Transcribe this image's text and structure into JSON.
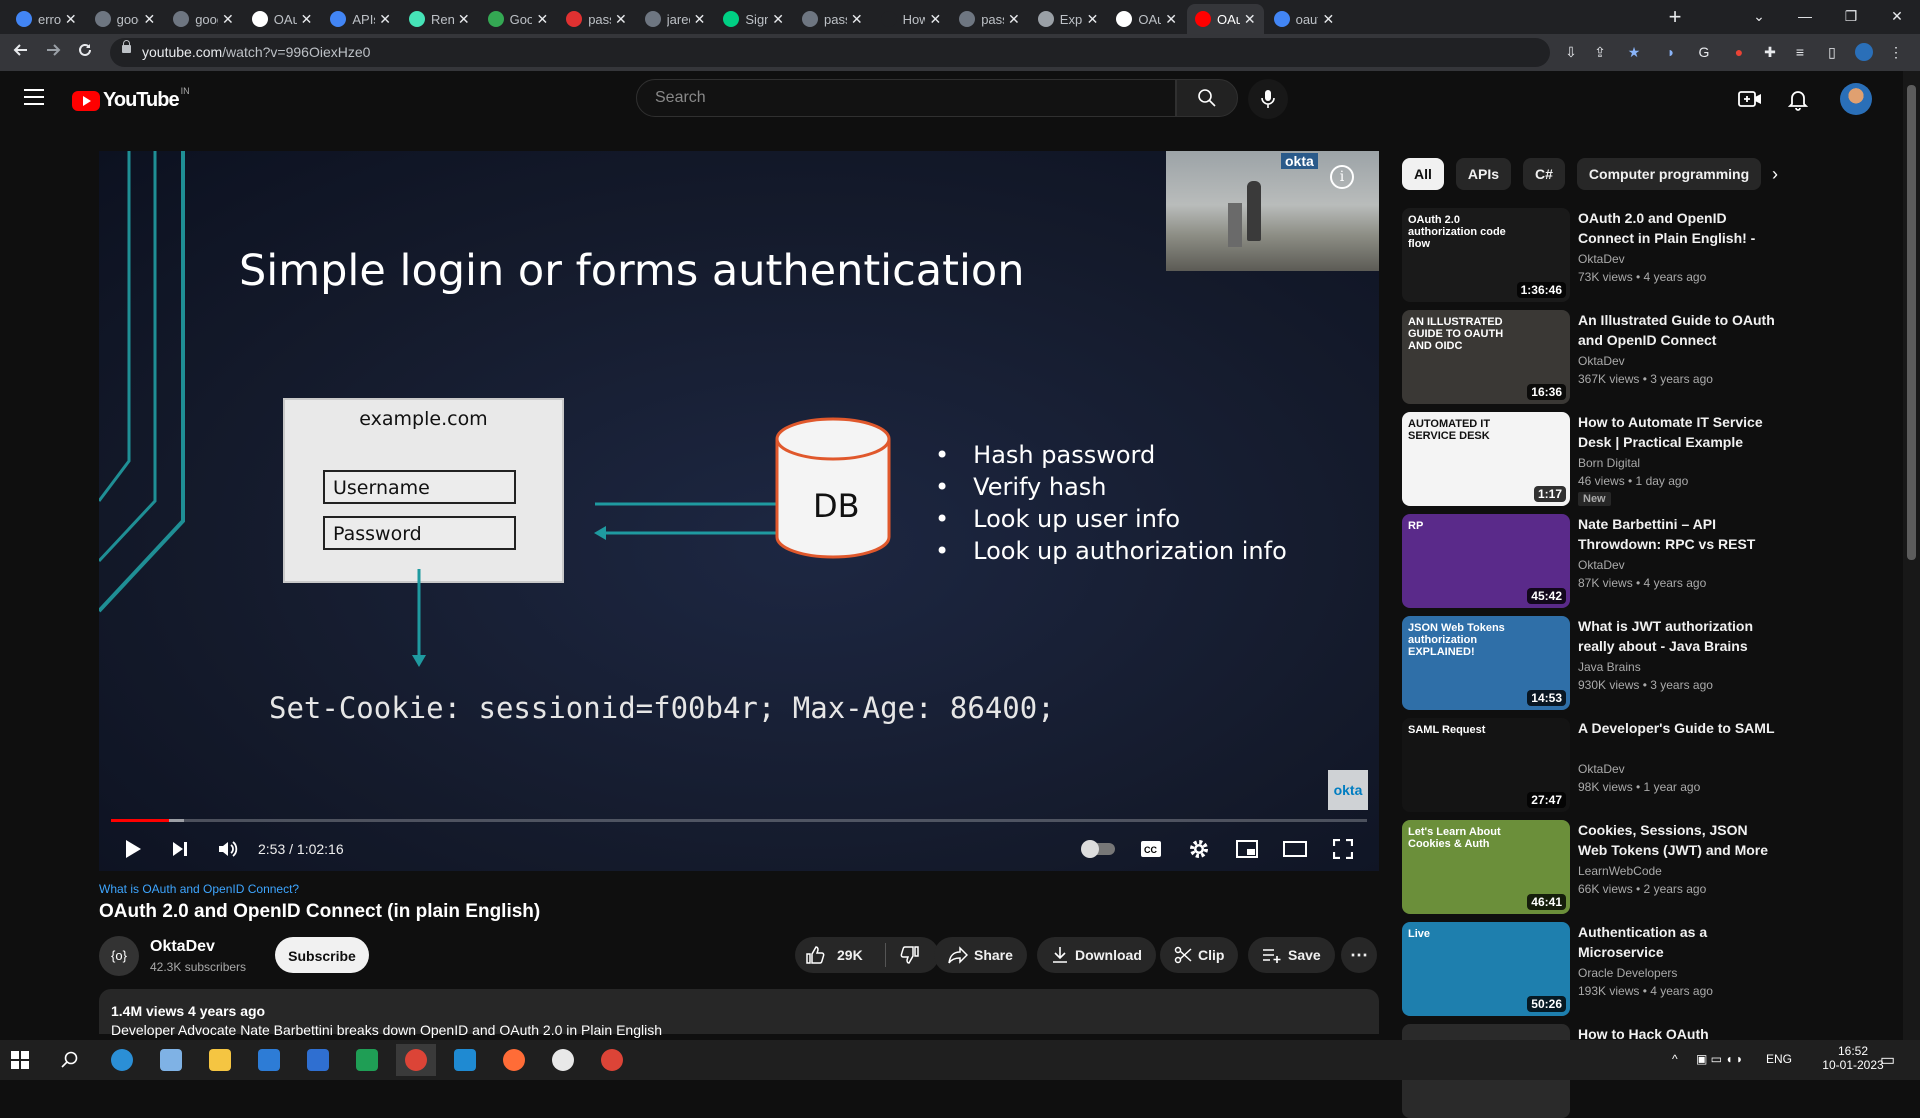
{
  "browser": {
    "tabs": [
      {
        "title": "error i",
        "color": "#4285f4"
      },
      {
        "title": "googl",
        "color": "#6e7681"
      },
      {
        "title": "googl",
        "color": "#6e7681"
      },
      {
        "title": "OAuth",
        "color": "#ffffff"
      },
      {
        "title": "APIs &",
        "color": "#4285f4"
      },
      {
        "title": "Rende",
        "color": "#46e3b7"
      },
      {
        "title": "Googl",
        "color": "#34a853"
      },
      {
        "title": "passp",
        "color": "#e03131"
      },
      {
        "title": "jaredh",
        "color": "#6e7681"
      },
      {
        "title": "Sign In",
        "color": "#00d084"
      },
      {
        "title": "passp",
        "color": "#6e7681"
      },
      {
        "title": "How t",
        "color": "#202124"
      },
      {
        "title": "passp",
        "color": "#6e7681"
      },
      {
        "title": "Expre",
        "color": "#9aa0a6"
      },
      {
        "title": "OAuth",
        "color": "#ffffff"
      },
      {
        "title": "OAuth",
        "color": "#ff0000",
        "active": true
      },
      {
        "title": "oauth",
        "color": "#4285f4"
      }
    ],
    "url_host": "youtube.com",
    "url_path": "/watch?v=996OiexHze0",
    "window_controls": [
      "⌄",
      "—",
      "❐",
      "✕"
    ]
  },
  "youtube": {
    "logo_text": "YouTube",
    "country_code": "IN",
    "search_placeholder": "Search"
  },
  "slide": {
    "title": "Simple login or forms authentication",
    "site": "example.com",
    "username_label": "Username",
    "password_label": "Password",
    "db_label": "DB",
    "bullets": [
      "Hash password",
      "Verify hash",
      "Look up user info",
      "Look up authorization info"
    ],
    "cookie": "Set-Cookie: sessionid=f00b4r; Max-Age: 86400;",
    "okta_logo": "okta",
    "cam_logo": "okta"
  },
  "player": {
    "time": "2:53 / 1:02:16",
    "played_fraction": 0.046,
    "buffered_fraction": 0.058
  },
  "video": {
    "series": "What is OAuth and OpenID Connect?",
    "title": "OAuth 2.0 and OpenID Connect (in plain English)",
    "channel": "OktaDev",
    "channel_avatar": "{o}",
    "subscribers": "42.3K subscribers",
    "subscribe_label": "Subscribe",
    "likes": "29K",
    "share_label": "Share",
    "download_label": "Download",
    "clip_label": "Clip",
    "save_label": "Save",
    "more_label": "⋯",
    "views_age": "1.4M views  4 years ago",
    "description": "Developer Advocate Nate Barbettini breaks down OpenID and OAuth 2.0 in Plain English"
  },
  "chips": [
    "All",
    "APIs",
    "C#",
    "Computer programming"
  ],
  "recommendations": [
    {
      "title": "OAuth 2.0 and OpenID Connect in Plain English! - Nate...",
      "channel": "OktaDev",
      "views": "73K views • 4 years ago",
      "duration": "1:36:46",
      "thumb": "#1a1a1a",
      "thumb_text": "OAuth 2.0 authorization code flow"
    },
    {
      "title": "An Illustrated Guide to OAuth and OpenID Connect",
      "channel": "OktaDev",
      "views": "367K views • 3 years ago",
      "duration": "16:36",
      "thumb": "#3a3835",
      "thumb_text": "AN ILLUSTRATED GUIDE TO OAUTH AND OIDC"
    },
    {
      "title": "How to Automate IT Service Desk | Practical Example",
      "channel": "Born Digital",
      "views": "46 views • 1 day ago",
      "duration": "1:17",
      "thumb": "#f4f4f4",
      "thumb_text": "AUTOMATED IT SERVICE DESK",
      "badge": "New"
    },
    {
      "title": "Nate Barbettini – API Throwdown: RPC vs REST vs...",
      "channel": "OktaDev",
      "views": "87K views • 4 years ago",
      "duration": "45:42",
      "thumb": "#5a2a8a",
      "thumb_text": "RP"
    },
    {
      "title": "What is JWT authorization really about - Java Brains",
      "channel": "Java Brains",
      "views": "930K views • 3 years ago",
      "duration": "14:53",
      "thumb": "#2f6fa8",
      "thumb_text": "JSON Web Tokens authorization EXPLAINED!"
    },
    {
      "title": "A Developer's Guide to SAML",
      "channel": "OktaDev",
      "views": "98K views • 1 year ago",
      "duration": "27:47",
      "thumb": "#141414",
      "thumb_text": "SAML Request"
    },
    {
      "title": "Cookies, Sessions, JSON Web Tokens (JWT) and More 🍪🔐",
      "channel": "LearnWebCode",
      "views": "66K views • 2 years ago",
      "duration": "46:41",
      "thumb": "#6b8f3a",
      "thumb_text": "Let's Learn About Cookies & Auth"
    },
    {
      "title": "Authentication as a Microservice",
      "channel": "Oracle Developers",
      "views": "193K views • 4 years ago",
      "duration": "50:26",
      "thumb": "#1e7fae",
      "thumb_text": "Live"
    },
    {
      "title": "How to Hack OAuth",
      "channel": "",
      "views": "",
      "duration": "",
      "thumb": "#2a2a2a",
      "thumb_text": ""
    }
  ],
  "taskbar": {
    "apps": [
      {
        "name": "edge",
        "color": "#2b8fd6"
      },
      {
        "name": "notepad",
        "color": "#7fb2e5"
      },
      {
        "name": "explorer",
        "color": "#f5c542"
      },
      {
        "name": "store",
        "color": "#2d7cd6"
      },
      {
        "name": "mail",
        "color": "#2f6fd1"
      },
      {
        "name": "excel-like",
        "color": "#1f9e55"
      },
      {
        "name": "chrome",
        "color": "#dc4437",
        "active": true
      },
      {
        "name": "vscode",
        "color": "#1f8ad2"
      },
      {
        "name": "postman",
        "color": "#ff6c37"
      },
      {
        "name": "mongodb",
        "color": "#e8e8e8"
      },
      {
        "name": "chrome-alt",
        "color": "#dc4437"
      }
    ],
    "lang": "ENG",
    "time": "16:52",
    "date": "10-01-2023"
  }
}
